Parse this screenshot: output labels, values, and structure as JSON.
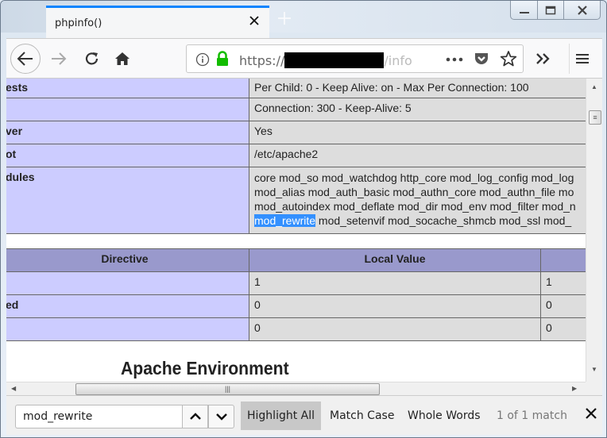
{
  "window": {
    "controls": {
      "minimize": "minimize-icon",
      "maximize": "maximize-icon",
      "close": "close-icon"
    }
  },
  "tab": {
    "title": "phpinfo()",
    "close_icon": "close-icon",
    "new_tab_icon": "plus-icon"
  },
  "navbar": {
    "back_icon": "arrow-left-icon",
    "forward_icon": "arrow-right-icon",
    "reload_icon": "reload-icon",
    "home_icon": "home-icon",
    "url": {
      "scheme": "https://",
      "redacted": true,
      "tail": "/info"
    },
    "page_actions_icon": "ellipsis-icon",
    "pocket_icon": "pocket-icon",
    "bookmark_icon": "star-icon",
    "overflow_icon": "double-chevron-icon",
    "menu_icon": "hamburger-icon"
  },
  "content": {
    "config_rows": [
      {
        "key": "ests",
        "value": "Per Child: 0 - Keep Alive: on - Max Per Connection: 100"
      },
      {
        "key": "",
        "value": "Connection: 300 - Keep-Alive: 5"
      },
      {
        "key": "ver",
        "value": "Yes"
      },
      {
        "key": "ot",
        "value": "/etc/apache2"
      }
    ],
    "modules_row": {
      "key": "dules",
      "lines": [
        "core mod_so mod_watchdog http_core mod_log_config mod_log",
        "mod_alias mod_auth_basic mod_authn_core mod_authn_file mo",
        "mod_autoindex mod_deflate mod_dir mod_env mod_filter mod_n"
      ],
      "highlight": "mod_rewrite",
      "last_line_rest": " mod_setenvif mod_socache_shmcb mod_ssl mod_"
    },
    "directive_table": {
      "headers": [
        "Directive",
        "Local Value",
        ""
      ],
      "rows": [
        {
          "directive": "",
          "local": "1",
          "master": "1"
        },
        {
          "directive": "ed",
          "local": "0",
          "master": "0"
        },
        {
          "directive": "",
          "local": "0",
          "master": "0"
        }
      ]
    },
    "section_heading": "Apache Environment"
  },
  "findbar": {
    "query": "mod_rewrite",
    "prev_icon": "chevron-up-icon",
    "next_icon": "chevron-down-icon",
    "highlight_all": "Highlight All",
    "match_case": "Match Case",
    "whole_words": "Whole Words",
    "status": "1 of 1 match",
    "close_icon": "close-icon"
  }
}
